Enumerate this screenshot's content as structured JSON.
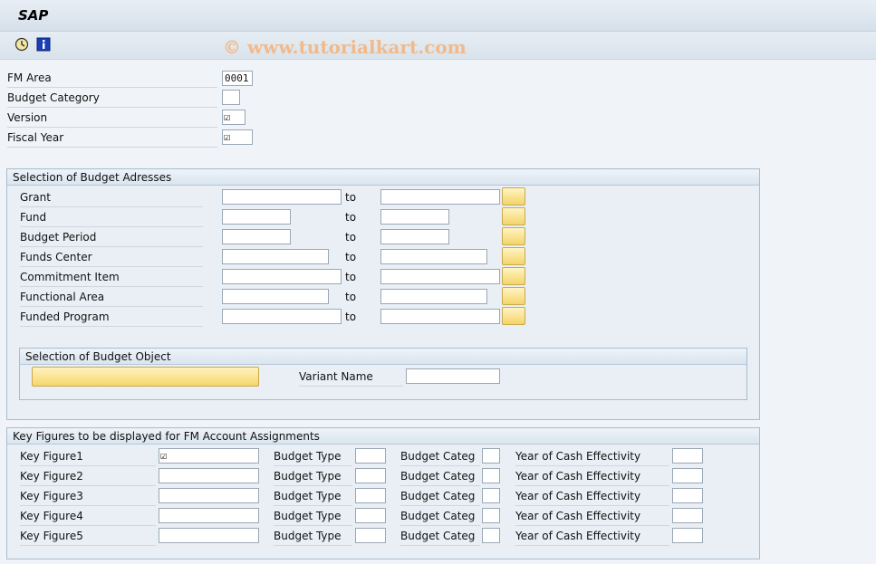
{
  "app": {
    "title": "SAP",
    "watermark": "© www.tutorialkart.com"
  },
  "toolbar": {
    "icons": [
      "execute-clock-icon",
      "info-icon"
    ]
  },
  "header_fields": [
    {
      "label": "FM Area",
      "value": "0001"
    },
    {
      "label": "Budget Category",
      "value": ""
    },
    {
      "label": "Version",
      "value": "☑"
    },
    {
      "label": "Fiscal Year",
      "value": "☑"
    }
  ],
  "budget_addresses": {
    "title": "Selection of Budget Adresses",
    "to_label": "to",
    "rows": [
      {
        "label": "Grant",
        "from": "",
        "to": ""
      },
      {
        "label": "Fund",
        "from": "",
        "to": ""
      },
      {
        "label": "Budget Period",
        "from": "",
        "to": ""
      },
      {
        "label": "Funds Center",
        "from": "",
        "to": ""
      },
      {
        "label": "Commitment Item",
        "from": "",
        "to": ""
      },
      {
        "label": "Functional Area",
        "from": "",
        "to": ""
      },
      {
        "label": "Funded Program",
        "from": "",
        "to": ""
      }
    ]
  },
  "budget_object": {
    "title": "Selection of Budget Object",
    "button_label": "",
    "variant_label": "Variant Name",
    "variant_value": ""
  },
  "key_figures": {
    "title": "Key Figures to be displayed for FM Account Assignments",
    "budget_type_label": "Budget Type",
    "budget_categ_label": "Budget Categ",
    "year_label": "Year of Cash Effectivity",
    "rows": [
      {
        "label": "Key Figure1",
        "value": "☑"
      },
      {
        "label": "Key Figure2",
        "value": ""
      },
      {
        "label": "Key Figure3",
        "value": ""
      },
      {
        "label": "Key Figure4",
        "value": ""
      },
      {
        "label": "Key Figure5",
        "value": ""
      }
    ]
  }
}
